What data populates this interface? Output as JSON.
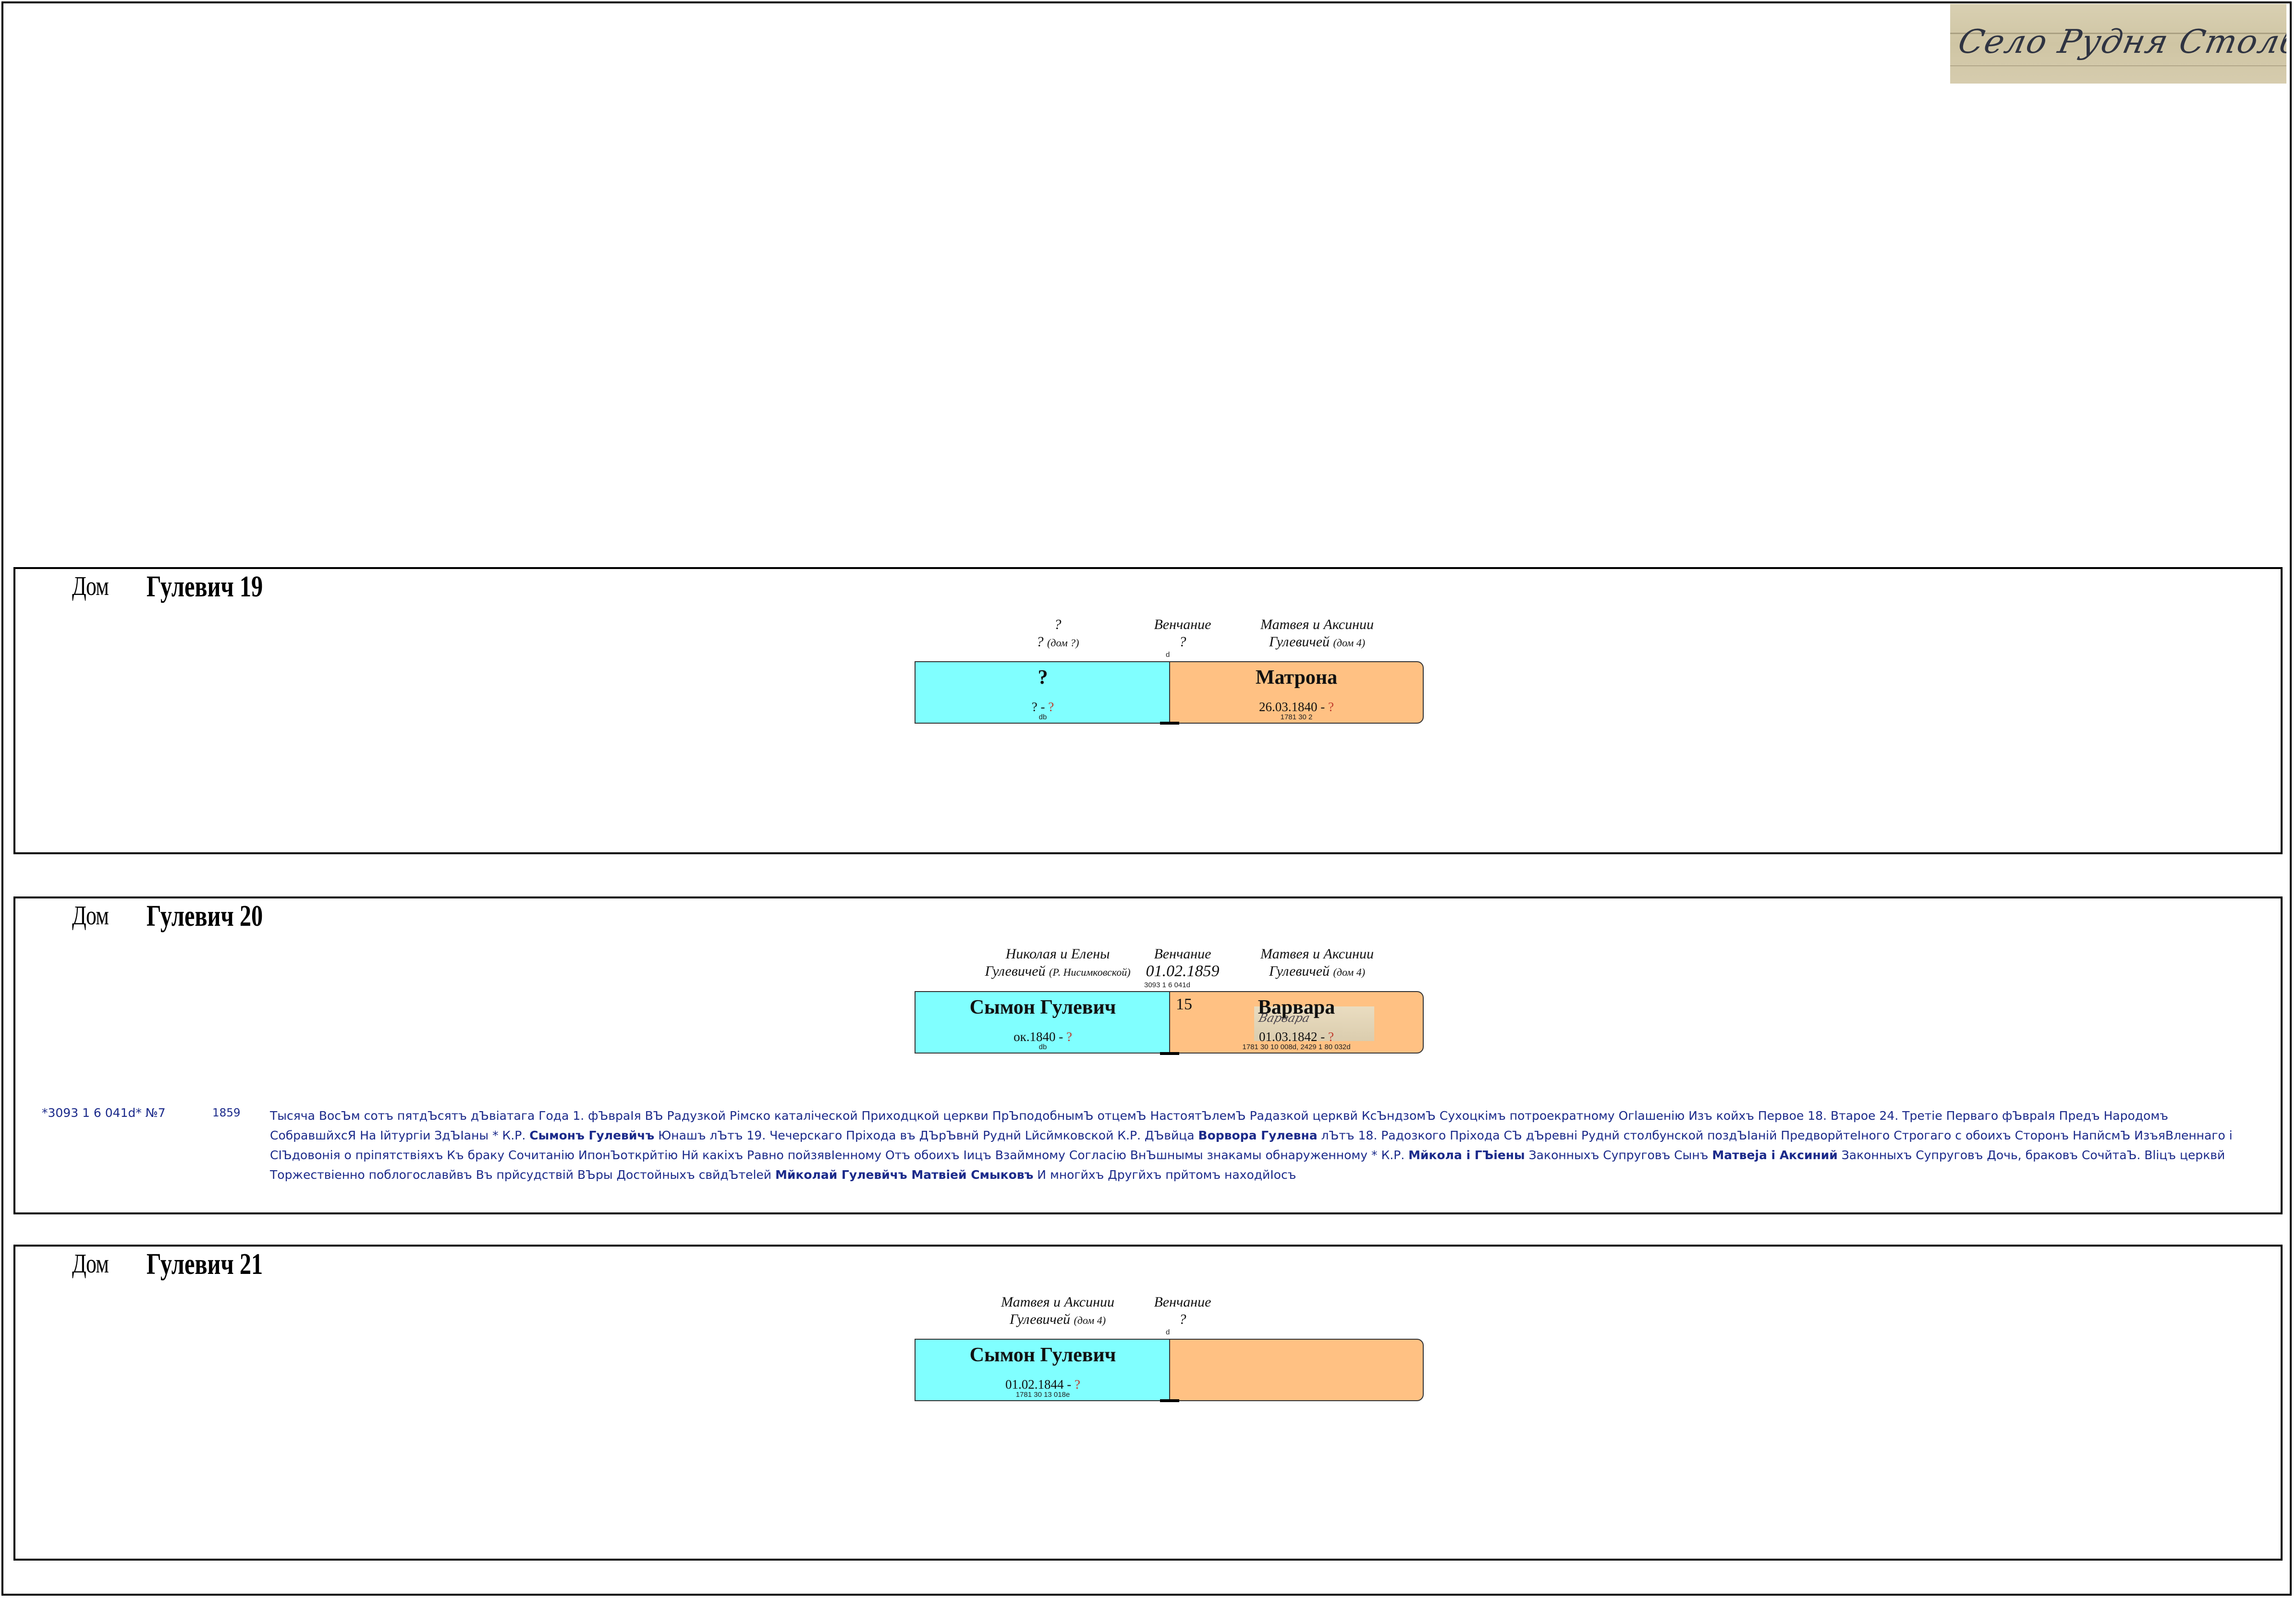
{
  "header": {
    "image_caption": "Село Рудня Столбунска"
  },
  "houses": [
    {
      "word": "Дом",
      "name": "Гулевич 19",
      "left_caption": {
        "line1": "?",
        "line2": "? ",
        "line2_small": "(дом ?)"
      },
      "marriage_caption": {
        "line1": "Венчание",
        "line2": "?",
        "ref": "d"
      },
      "right_caption": {
        "line1": "Матвея и Аксинии",
        "line2": "Гулевичей ",
        "line2_small": "(дом 4)"
      },
      "husband": {
        "name": "?",
        "dates_start": "? - ",
        "dates_end": "?",
        "ref": "db"
      },
      "wife": {
        "name": "Матрона",
        "dates_start": "26.03.1840 - ",
        "dates_end": "?",
        "ref": "1781 30 2"
      }
    },
    {
      "word": "Дом",
      "name": "Гулевич 20",
      "left_caption": {
        "line1": "Николая и Елены",
        "line2": "Гулевичей ",
        "line2_small": "(Р. Нисимковской)"
      },
      "marriage_caption": {
        "line1": "Венчание",
        "line2": "01.02.1859",
        "ref": "3093 1 6 041d"
      },
      "right_caption": {
        "line1": "Матвея и Аксинии",
        "line2": "Гулевичей ",
        "line2_small": "(дом 4)"
      },
      "husband": {
        "name": "Сымон Гулевич",
        "dates_start": "ок.1840 - ",
        "dates_end": "?",
        "ref": "db"
      },
      "wife": {
        "name": "Варвара",
        "dates_start": "01.03.1842 - ",
        "dates_end": "?",
        "ref": "1781 30 10 008d, 2429 1 80 032d"
      },
      "wife_age": "15",
      "record": {
        "id": "*3093 1 6 041d* №7",
        "year": "1859",
        "segments": [
          {
            "t": "Тысяча ВосЪм сотъ пятдЪсятъ дЪвіатага Года 1. фЪвраІя ВЪ Радузкой Рімско каталіческой Приходцкой церкви ПрЪподобнымЪ отцемЪ НастоятЪлемЪ Радазкой церквй КсЪндзомЪ Сухоцкімъ потроекратному Огlашенію Изъ койхъ Первое 18. Втарое 24. Третіе Перваго фЪвраІя Предъ Народомъ СобравшйхсЯ На Ійтургіи ЗдЪІаны * К.Р. ",
            "b": false
          },
          {
            "t": "Сымонъ Гулевйчъ",
            "b": true
          },
          {
            "t": " Юнашъ лЪтъ 19. Чечерскаго Пріхода въ ДЪрЪвнй Руднй Lйсймковской К.Р. ДЪвйца ",
            "b": false
          },
          {
            "t": "Ворвора Гулевна",
            "b": true
          },
          {
            "t": " лЪтъ 18. Радозкого Пріхода СЪ дЪревні Руднй столбунской поздЪІаній ПредворйтеІного Строгаго с обоихъ Сторонъ НапйсмЪ ИзъяВленнаго і СІЪдовонія о пріпятствіяхъ Къ браку Сочитанію ИпонЪоткрйтію Нй какіхъ Равно пойзявІенному Отъ обоихъ Іицъ Взаймному Соглacію ВнЪшнымы знакамы обнаруженному * К.Р. ",
            "b": false
          },
          {
            "t": "Мйкола і ГЪіены",
            "b": true
          },
          {
            "t": " Законныхъ Супруговъ Сынъ ",
            "b": false
          },
          {
            "t": "Матвеја і Аксиний",
            "b": true
          },
          {
            "t": " Законныхъ Супруговъ Дочь, браковъ СочйтаЪ. Вlіцъ церквй Торжествіенно поблогославйвъ Въ прйсудствій ВЪры Достойныхъ свйдЪтеlей ",
            "b": false
          },
          {
            "t": "Мйколай Гулевйчъ Матвіей Смыковъ",
            "b": true
          },
          {
            "t": " И многйхъ Другйхъ прйтомъ находйІосъ",
            "b": false
          }
        ]
      }
    },
    {
      "word": "Дом",
      "name": "Гулевич 21",
      "left_caption": {
        "line1": "Матвея и Аксинии",
        "line2": "Гулевичей ",
        "line2_small": "(дом 4)"
      },
      "marriage_caption": {
        "line1": "Венчание",
        "line2": "?",
        "ref": "d"
      },
      "husband": {
        "name": "Сымон Гулевич",
        "dates_start": "01.02.1844 - ",
        "dates_end": "?",
        "ref": "1781 30 13 018e"
      },
      "wife": {
        "name": ""
      }
    }
  ],
  "colors": {
    "male": "#80ffff",
    "female": "#ffc183",
    "record_text": "#1b2a8a",
    "unknown_date": "#c0392b"
  }
}
